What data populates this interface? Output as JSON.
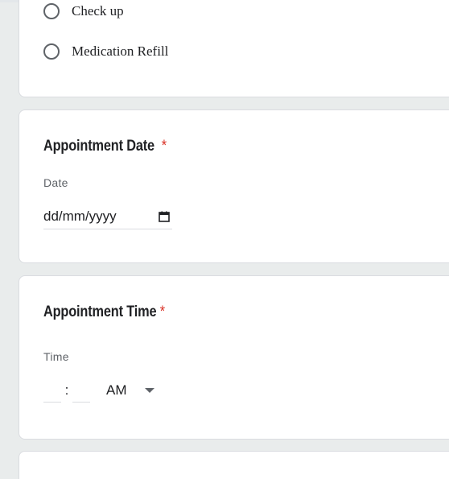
{
  "radio_options": [
    {
      "label": "Check up"
    },
    {
      "label": "Medication Refill"
    }
  ],
  "appointment_date": {
    "title": "Appointment Date",
    "required_mark": "*",
    "field_label": "Date",
    "value": "dd/mm/yyyy",
    "icon": "calendar-icon"
  },
  "appointment_time": {
    "title": "Appointment Time",
    "required_mark": "*",
    "field_label": "Time",
    "hour": "",
    "minute": "",
    "separator": ":",
    "period": "AM",
    "icon": "chevron-down-icon"
  },
  "colors": {
    "required": "#d93025",
    "background": "#e9ecec",
    "card": "#ffffff"
  }
}
